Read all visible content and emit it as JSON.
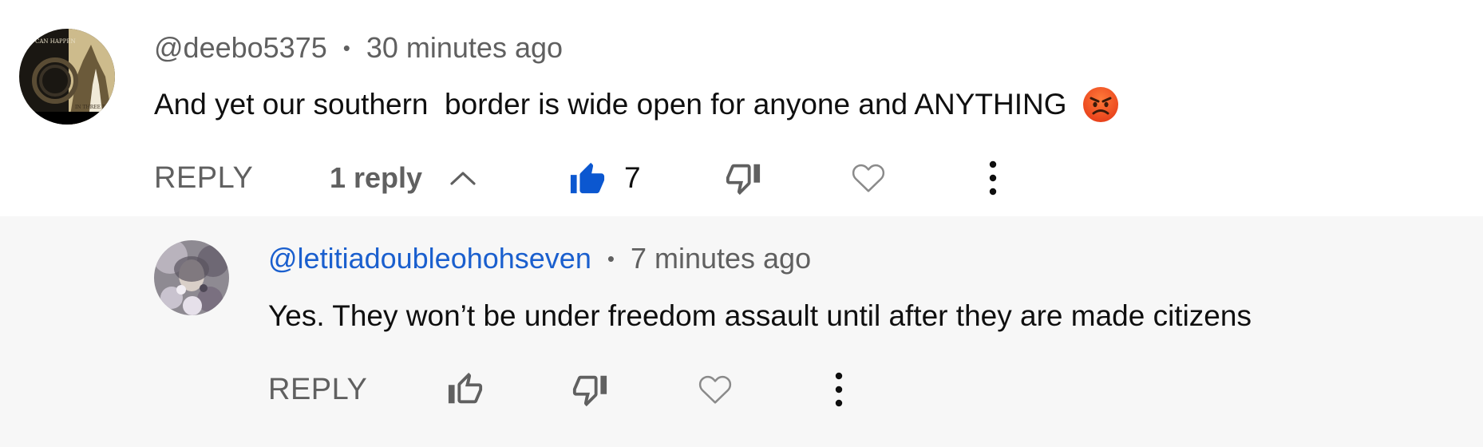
{
  "comment": {
    "handle": "@deebo5375",
    "separator": "•",
    "time": "30 minutes ago",
    "text": "And yet our southern  border is wide open for anyone and ANYTHING",
    "emoji": "😡",
    "reply_label": "REPLY",
    "replies_label": "1 reply",
    "like_count": "7",
    "avatar_caption_top": "CAN HAPPEN",
    "avatar_caption_bottom": "IN THREE DA"
  },
  "reply": {
    "handle": "@letitiadoubleohohseven",
    "separator": "•",
    "time": "7 minutes ago",
    "text": "Yes. They won’t be under freedom assault until after they are made citizens",
    "reply_label": "REPLY"
  },
  "colors": {
    "like_active": "#0b57d0",
    "handle_link": "#1a5fce",
    "secondary_text": "#606060",
    "reply_background": "#f7f7f7"
  }
}
